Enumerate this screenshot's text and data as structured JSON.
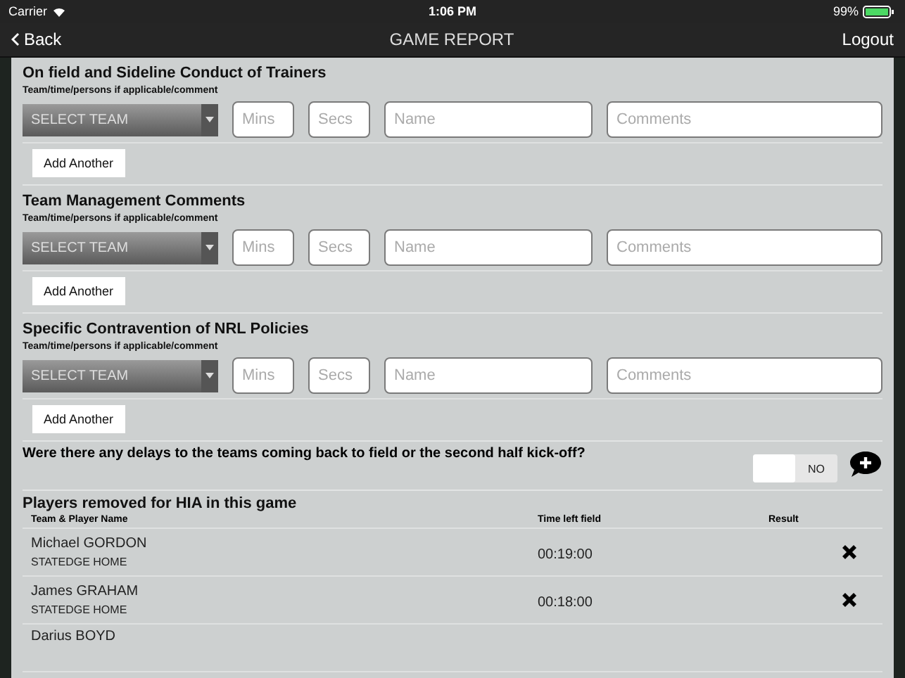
{
  "status_bar": {
    "carrier": "Carrier",
    "time": "1:06 PM",
    "battery": "99%"
  },
  "nav": {
    "back": "Back",
    "title": "GAME REPORT",
    "logout": "Logout"
  },
  "sections": [
    {
      "title": "On field and Sideline Conduct of Trainers",
      "subtitle": "Team/time/persons if applicable/comment",
      "select": "SELECT TEAM",
      "fields": [
        {
          "kind": "mins",
          "placeholder": "Mins"
        },
        {
          "kind": "secs",
          "placeholder": "Secs"
        },
        {
          "kind": "name",
          "placeholder": "Name"
        },
        {
          "kind": "comments",
          "placeholder": "Comments"
        }
      ],
      "button": "Add Another"
    },
    {
      "title": "Team Management Comments",
      "subtitle": "Team/time/persons if applicable/comment",
      "select": "SELECT TEAM",
      "fields": [
        {
          "kind": "mins",
          "placeholder": "Mins"
        },
        {
          "kind": "secs",
          "placeholder": "Secs"
        },
        {
          "kind": "name",
          "placeholder": "Name"
        },
        {
          "kind": "comments",
          "placeholder": "Comments"
        }
      ],
      "button": "Add Another"
    },
    {
      "title": "Specific Contravention of NRL Policies",
      "subtitle": "Team/time/persons if applicable/comment",
      "select": "SELECT TEAM",
      "fields": [
        {
          "kind": "mins",
          "placeholder": "Mins"
        },
        {
          "kind": "secs",
          "placeholder": "Secs"
        },
        {
          "kind": "name",
          "placeholder": "Name"
        },
        {
          "kind": "comments",
          "placeholder": "Comments"
        }
      ],
      "button": "Add Another"
    }
  ],
  "delay": {
    "question": "Were there any delays to the teams coming back to field or the second half kick-off?",
    "toggle": {
      "label": "NO",
      "on": false
    }
  },
  "hia": {
    "title": "Players removed for HIA in this game",
    "columns": [
      "Team & Player Name",
      "Time left field",
      "Result"
    ],
    "rows": [
      {
        "name": "Michael GORDON",
        "team": "STATEDGE HOME",
        "time": "00:19:00"
      },
      {
        "name": "James GRAHAM",
        "team": "STATEDGE HOME",
        "time": "00:18:00"
      },
      {
        "name": "Darius BOYD"
      }
    ]
  }
}
